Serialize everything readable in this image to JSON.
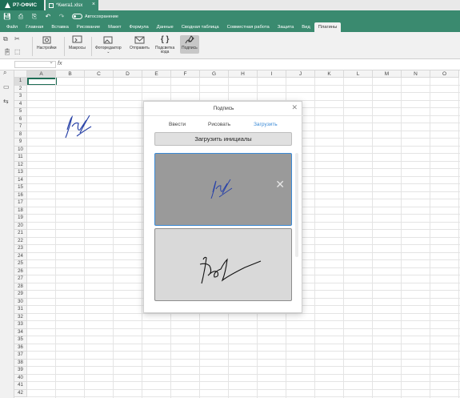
{
  "app": {
    "name": "Р7-ОФИС",
    "doc_tab": "*Книга1.xlsx"
  },
  "quickbar": {
    "autosave_label": "Автосохранение"
  },
  "menu": [
    "Файл",
    "Главная",
    "Вставка",
    "Рисование",
    "Макет",
    "Формула",
    "Данные",
    "Сводная таблица",
    "Совместная работа",
    "Защита",
    "Вид",
    "Плагины"
  ],
  "menu_active": "Плагины",
  "ribbon": {
    "settings_label": "Настройки",
    "macros_label": "Макросы",
    "photo_label": "Фоторедактор",
    "send_label": "Отправить",
    "highlight_label_1": "Подсветка",
    "highlight_label_2": "кода",
    "signature_label": "Подпись"
  },
  "formula": {
    "fx": "fx"
  },
  "columns": [
    "A",
    "B",
    "C",
    "D",
    "E",
    "F",
    "G",
    "H",
    "I",
    "J",
    "K",
    "L",
    "M",
    "N",
    "O"
  ],
  "rows": [
    "1",
    "2",
    "3",
    "4",
    "5",
    "6",
    "7",
    "8",
    "9",
    "10",
    "11",
    "12",
    "13",
    "14",
    "15",
    "16",
    "17",
    "18",
    "19",
    "20",
    "21",
    "22",
    "23",
    "24",
    "25",
    "26",
    "27",
    "28",
    "29",
    "30",
    "31",
    "32",
    "33",
    "34",
    "35",
    "36",
    "37",
    "38",
    "39",
    "40",
    "41",
    "42"
  ],
  "dialog": {
    "title": "Подпись",
    "tabs": [
      "Ввести",
      "Рисовать",
      "Загрузить"
    ],
    "active_tab": "Загрузить",
    "upload_button": "Загрузить инициалы",
    "delete_glyph": "✕",
    "close_glyph": "✕"
  },
  "colors": {
    "brand": "#3a8a6f",
    "accent": "#3a8ad6",
    "signature_ink": "#2b44a8"
  }
}
